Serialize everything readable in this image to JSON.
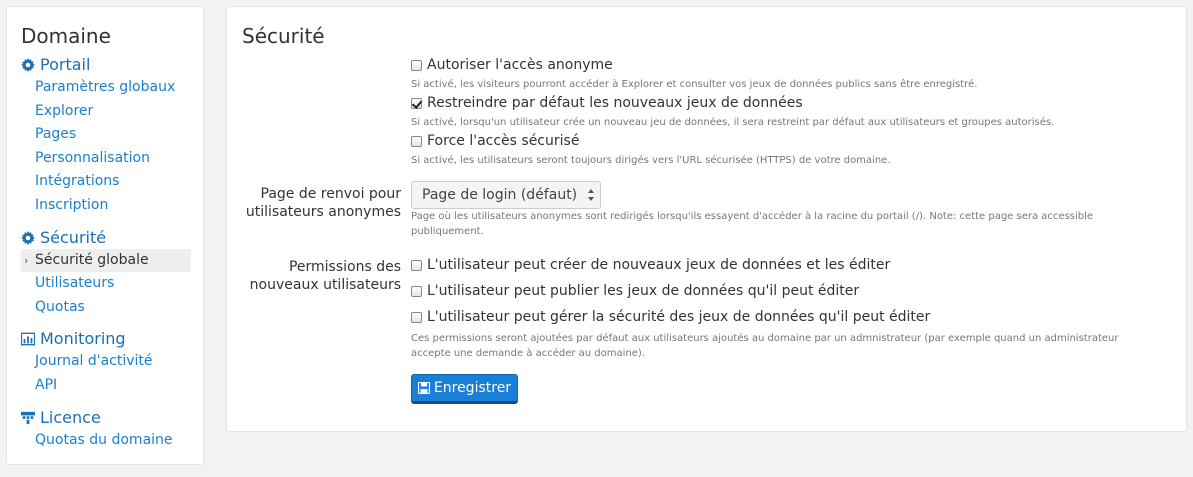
{
  "sidebar": {
    "title": "Domaine",
    "groups": [
      {
        "label": "Portail",
        "icon": "gear-icon",
        "items": [
          "Paramètres globaux",
          "Explorer",
          "Pages",
          "Personnalisation",
          "Intégrations",
          "Inscription"
        ]
      },
      {
        "label": "Sécurité",
        "icon": "gear-icon",
        "items": [
          "Sécurité globale",
          "Utilisateurs",
          "Quotas"
        ]
      },
      {
        "label": "Monitoring",
        "icon": "bar-chart-icon",
        "items": [
          "Journal d'activité",
          "API"
        ]
      },
      {
        "label": "Licence",
        "icon": "sitemap-icon",
        "items": [
          "Quotas du domaine"
        ]
      }
    ],
    "active_item": "Sécurité globale"
  },
  "main": {
    "title": "Sécurité",
    "options": [
      {
        "label": "Autoriser l'accès anonyme",
        "checked": false,
        "help": "Si activé, les visiteurs pourront accéder à Explorer et consulter vos jeux de données publics sans être enregistré."
      },
      {
        "label": "Restreindre par défaut les nouveaux jeux de données",
        "checked": true,
        "help": "Si activé, lorsqu'un utilisateur crée un nouveau jeu de données, il sera restreint par défaut aux utilisateurs et groupes autorisés."
      },
      {
        "label": "Force l'accès sécurisé",
        "checked": false,
        "help": "Si activé, les utilisateurs seront toujours dirigés vers l'URL sécurisée (HTTPS) de votre domaine."
      }
    ],
    "redirect": {
      "label_line1": "Page de renvoi pour",
      "label_line2": "utilisateurs anonymes",
      "selected": "Page de login (défaut)",
      "help_line1": "Page où les utilisateurs anonymes sont redirigés lorsqu'ils essayent d'accéder à la racine du portail (/). Note: cette page sera accessible",
      "help_line2": "publiquement."
    },
    "permissions": {
      "label_line1": "Permissions des",
      "label_line2": "nouveaux utilisateurs",
      "items": [
        {
          "label": "L'utilisateur peut créer de nouveaux jeux de données et les éditer",
          "checked": false
        },
        {
          "label": "L'utilisateur peut publier les jeux de données qu'il peut éditer",
          "checked": false
        },
        {
          "label": "L'utilisateur peut gérer la sécurité des jeux de données qu'il peut éditer",
          "checked": false
        }
      ],
      "help_line1": "Ces permissions seront ajoutées par défaut aux utilisateurs ajoutés au domaine par un admnistrateur (par exemple quand un administrateur",
      "help_line2": "accepte une demande à accéder au domaine)."
    },
    "save_label": "Enregistrer"
  },
  "colors": {
    "link": "#1a7fcf",
    "button": "#1a7fd6",
    "help_text": "#777777"
  }
}
